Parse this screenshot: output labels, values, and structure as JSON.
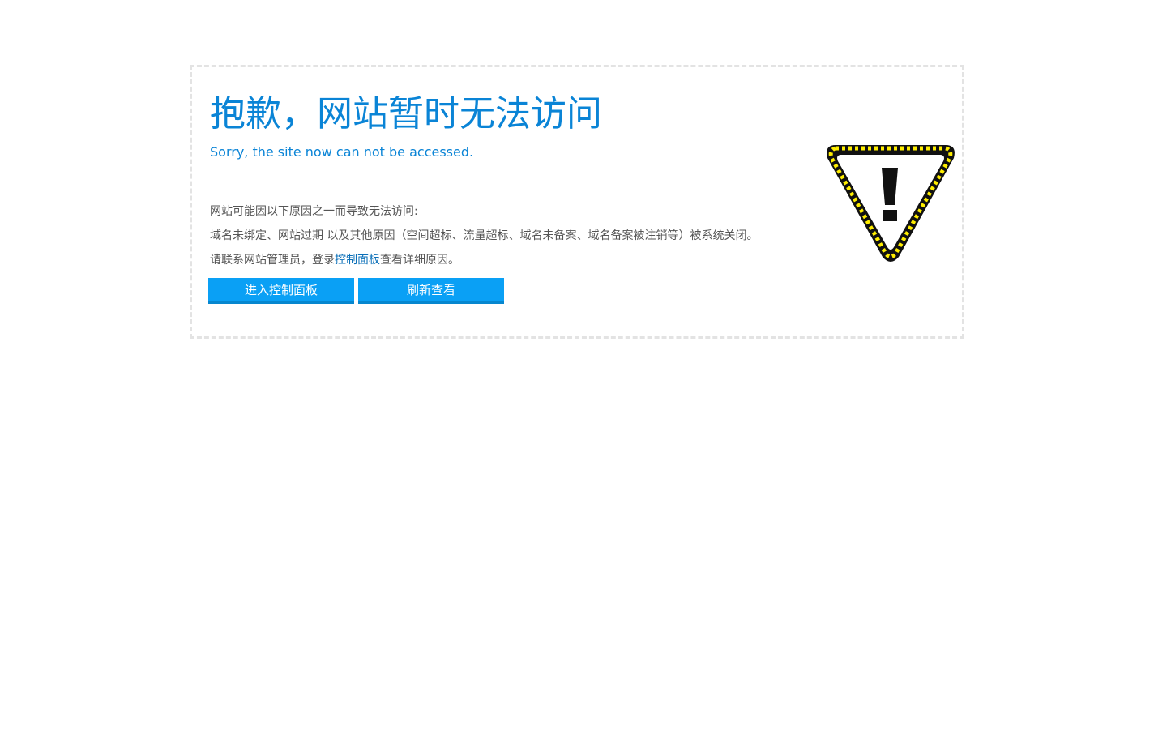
{
  "error": {
    "title": "抱歉，网站暂时无法访问",
    "subtitle": "Sorry, the site now can not be accessed.",
    "reasons_intro": "网站可能因以下原因之一而导致无法访问:",
    "reasons_detail": "域名未绑定、网站过期 以及其他原因（空间超标、流量超标、域名未备案、域名备案被注销等）被系统关闭。",
    "contact_prefix": "请联系网站管理员，登录",
    "contact_link": "控制面板",
    "contact_suffix": "查看详细原因。"
  },
  "buttons": {
    "console": "进入控制面板",
    "refresh": "刷新查看"
  },
  "icon": {
    "name": "warning-triangle-icon",
    "stripe_color": "#ffee00",
    "dark_color": "#111111"
  },
  "colors": {
    "title": "#0a84d6",
    "button": "#0aa0f5",
    "border": "#e3e3e3"
  }
}
